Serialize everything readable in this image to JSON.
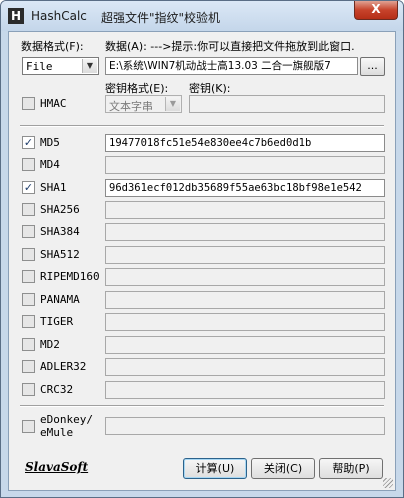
{
  "window": {
    "app_title": "HashCalc",
    "subtitle": "超强文件\"指纹\"校验机",
    "app_icon_letter": "H",
    "close_glyph": "X"
  },
  "data_format": {
    "label": "数据格式(F):",
    "value": "File"
  },
  "data": {
    "label": "数据(A): --->提示:你可以直接把文件拖放到此窗口.",
    "value": "E:\\系统\\WIN7机动战士高13.03 二合一旗舰版7",
    "browse_label": "..."
  },
  "hmac": {
    "label": "HMAC",
    "checked": false,
    "key_format_label": "密钥格式(E):",
    "key_format_value": "文本字串",
    "key_label": "密钥(K):",
    "key_value": ""
  },
  "hashes": [
    {
      "name": "MD5",
      "checked": true,
      "value": "19477018fc51e54e830ee4c7b6ed0d1b"
    },
    {
      "name": "MD4",
      "checked": false,
      "value": ""
    },
    {
      "name": "SHA1",
      "checked": true,
      "value": "96d361ecf012db35689f55ae63bc18bf98e1e542"
    },
    {
      "name": "SHA256",
      "checked": false,
      "value": ""
    },
    {
      "name": "SHA384",
      "checked": false,
      "value": ""
    },
    {
      "name": "SHA512",
      "checked": false,
      "value": ""
    },
    {
      "name": "RIPEMD160",
      "checked": false,
      "value": ""
    },
    {
      "name": "PANAMA",
      "checked": false,
      "value": ""
    },
    {
      "name": "TIGER",
      "checked": false,
      "value": ""
    },
    {
      "name": "MD2",
      "checked": false,
      "value": ""
    },
    {
      "name": "ADLER32",
      "checked": false,
      "value": ""
    },
    {
      "name": "CRC32",
      "checked": false,
      "value": ""
    }
  ],
  "edonkey": {
    "label_line1": "eDonkey/",
    "label_line2": "eMule",
    "checked": false,
    "value": ""
  },
  "footer": {
    "logo": "SlavaSoft",
    "calculate_label": "计算(U)",
    "close_label": "关闭(C)",
    "help_label": "帮助(P)"
  },
  "check_glyph": "✓",
  "dropdown_glyph": "▼"
}
